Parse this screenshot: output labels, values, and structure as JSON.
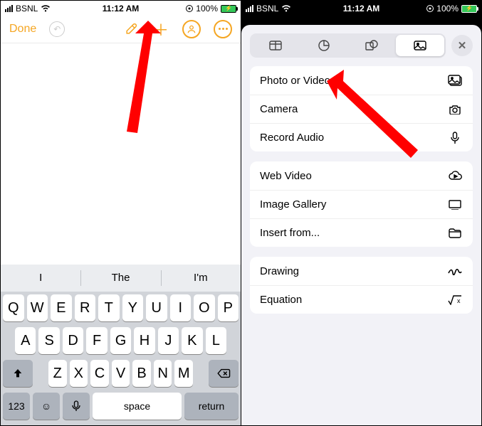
{
  "status": {
    "carrier": "BSNL",
    "time": "11:12 AM",
    "battery_pct": "100%"
  },
  "left": {
    "done": "Done",
    "suggestions": [
      "I",
      "The",
      "I'm"
    ],
    "keys_row1": [
      "Q",
      "W",
      "E",
      "R",
      "T",
      "Y",
      "U",
      "I",
      "O",
      "P"
    ],
    "keys_row2": [
      "A",
      "S",
      "D",
      "F",
      "G",
      "H",
      "J",
      "K",
      "L"
    ],
    "keys_row3": [
      "Z",
      "X",
      "C",
      "V",
      "B",
      "N",
      "M"
    ],
    "key_123": "123",
    "key_space": "space",
    "key_return": "return"
  },
  "right": {
    "group1": [
      {
        "label": "Photo or Video",
        "icon": "photo"
      },
      {
        "label": "Camera",
        "icon": "camera"
      },
      {
        "label": "Record Audio",
        "icon": "mic"
      }
    ],
    "group2": [
      {
        "label": "Web Video",
        "icon": "cloud"
      },
      {
        "label": "Image Gallery",
        "icon": "gallery"
      },
      {
        "label": "Insert from...",
        "icon": "folder"
      }
    ],
    "group3": [
      {
        "label": "Drawing",
        "icon": "scribble"
      },
      {
        "label": "Equation",
        "icon": "sqrt"
      }
    ]
  }
}
